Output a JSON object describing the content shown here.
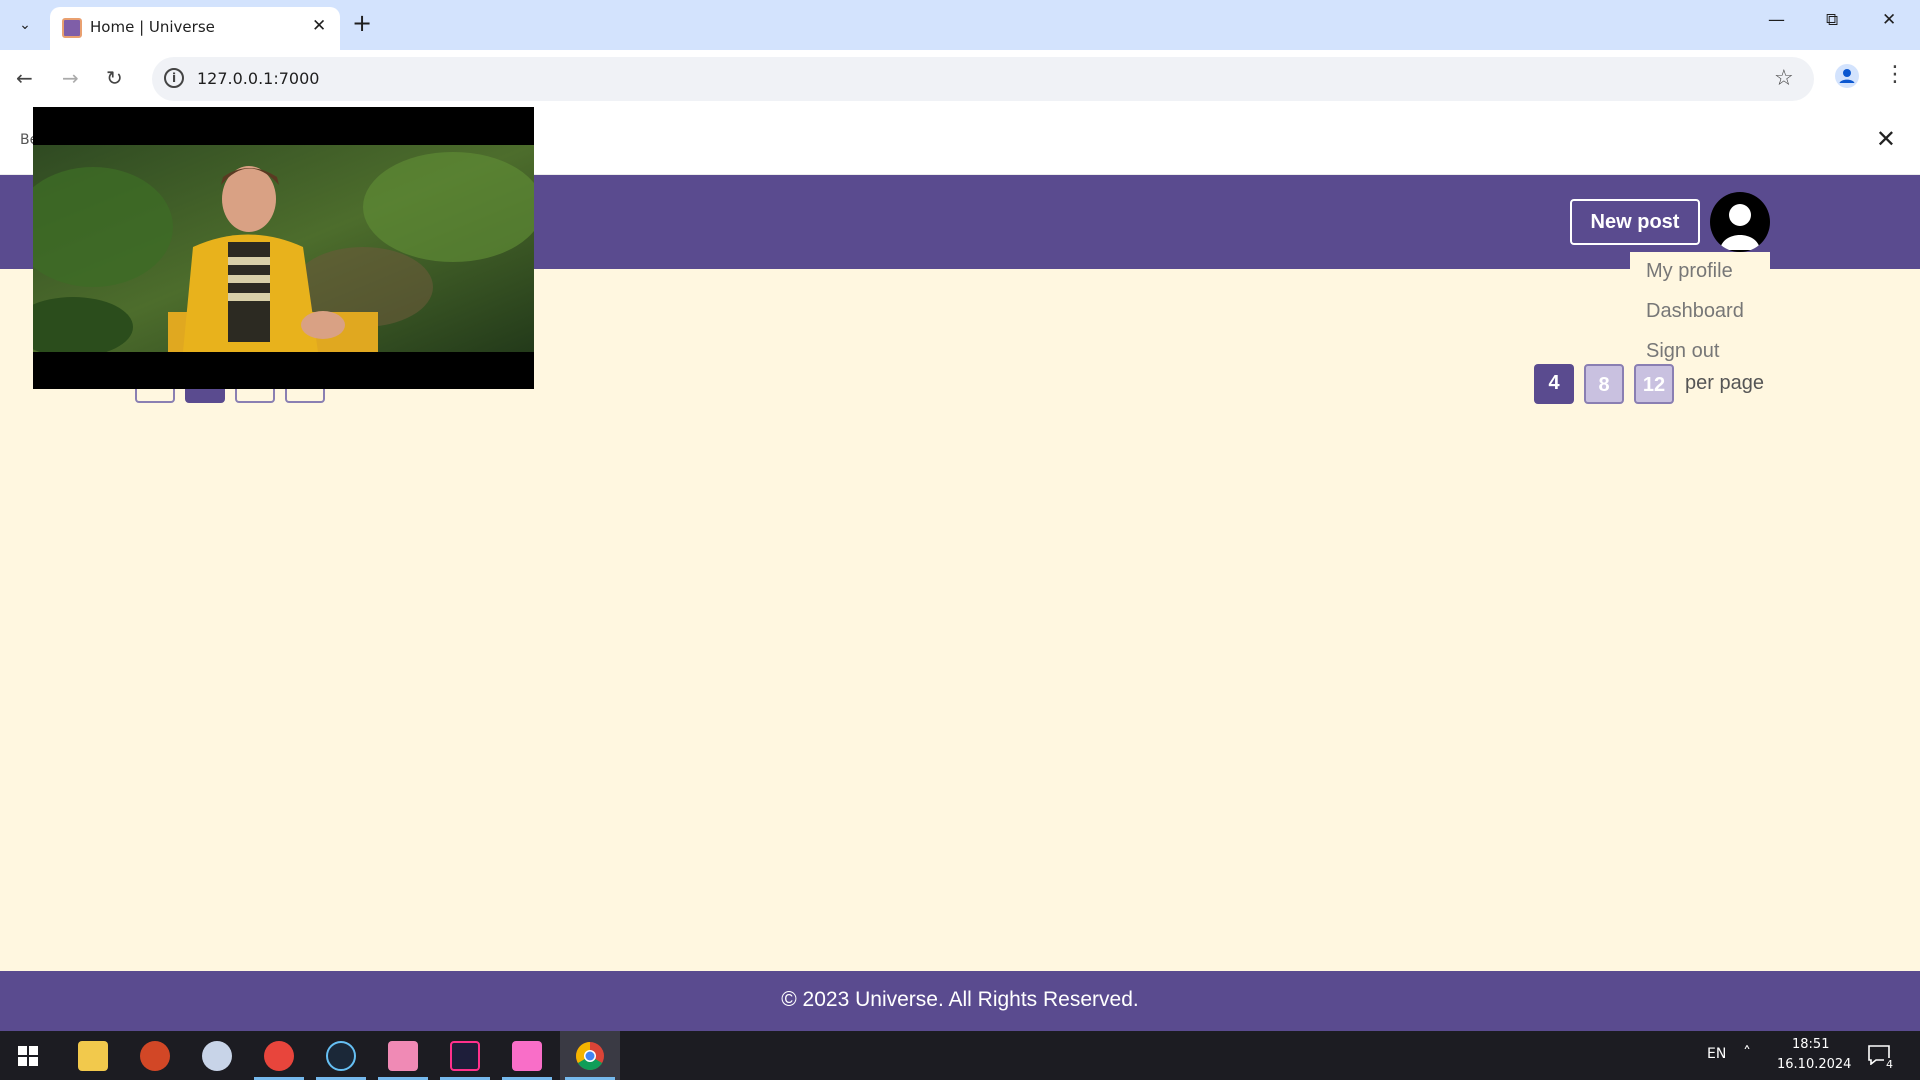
{
  "browser": {
    "tab_title": "Home | Universe",
    "url": "127.0.0.1:7000"
  },
  "notice": {
    "visible_text": "Be"
  },
  "header": {
    "new_post_label": "New post"
  },
  "user_menu": {
    "items": [
      "My profile",
      "Dashboard",
      "Sign out"
    ]
  },
  "pagination": {
    "per_page_options": [
      "4",
      "8",
      "12"
    ],
    "selected_per_page": "4",
    "per_page_label": "per page"
  },
  "footer": {
    "copyright": "© 2023 Universe. All Rights Reserved."
  },
  "taskbar": {
    "language": "EN",
    "time": "18:51",
    "date": "16.10.2024",
    "notification_count": "4"
  },
  "colors": {
    "brand_purple": "#5a4b8f",
    "page_bg": "#fff7e0",
    "perpage_inactive": "#c9c1e0"
  }
}
